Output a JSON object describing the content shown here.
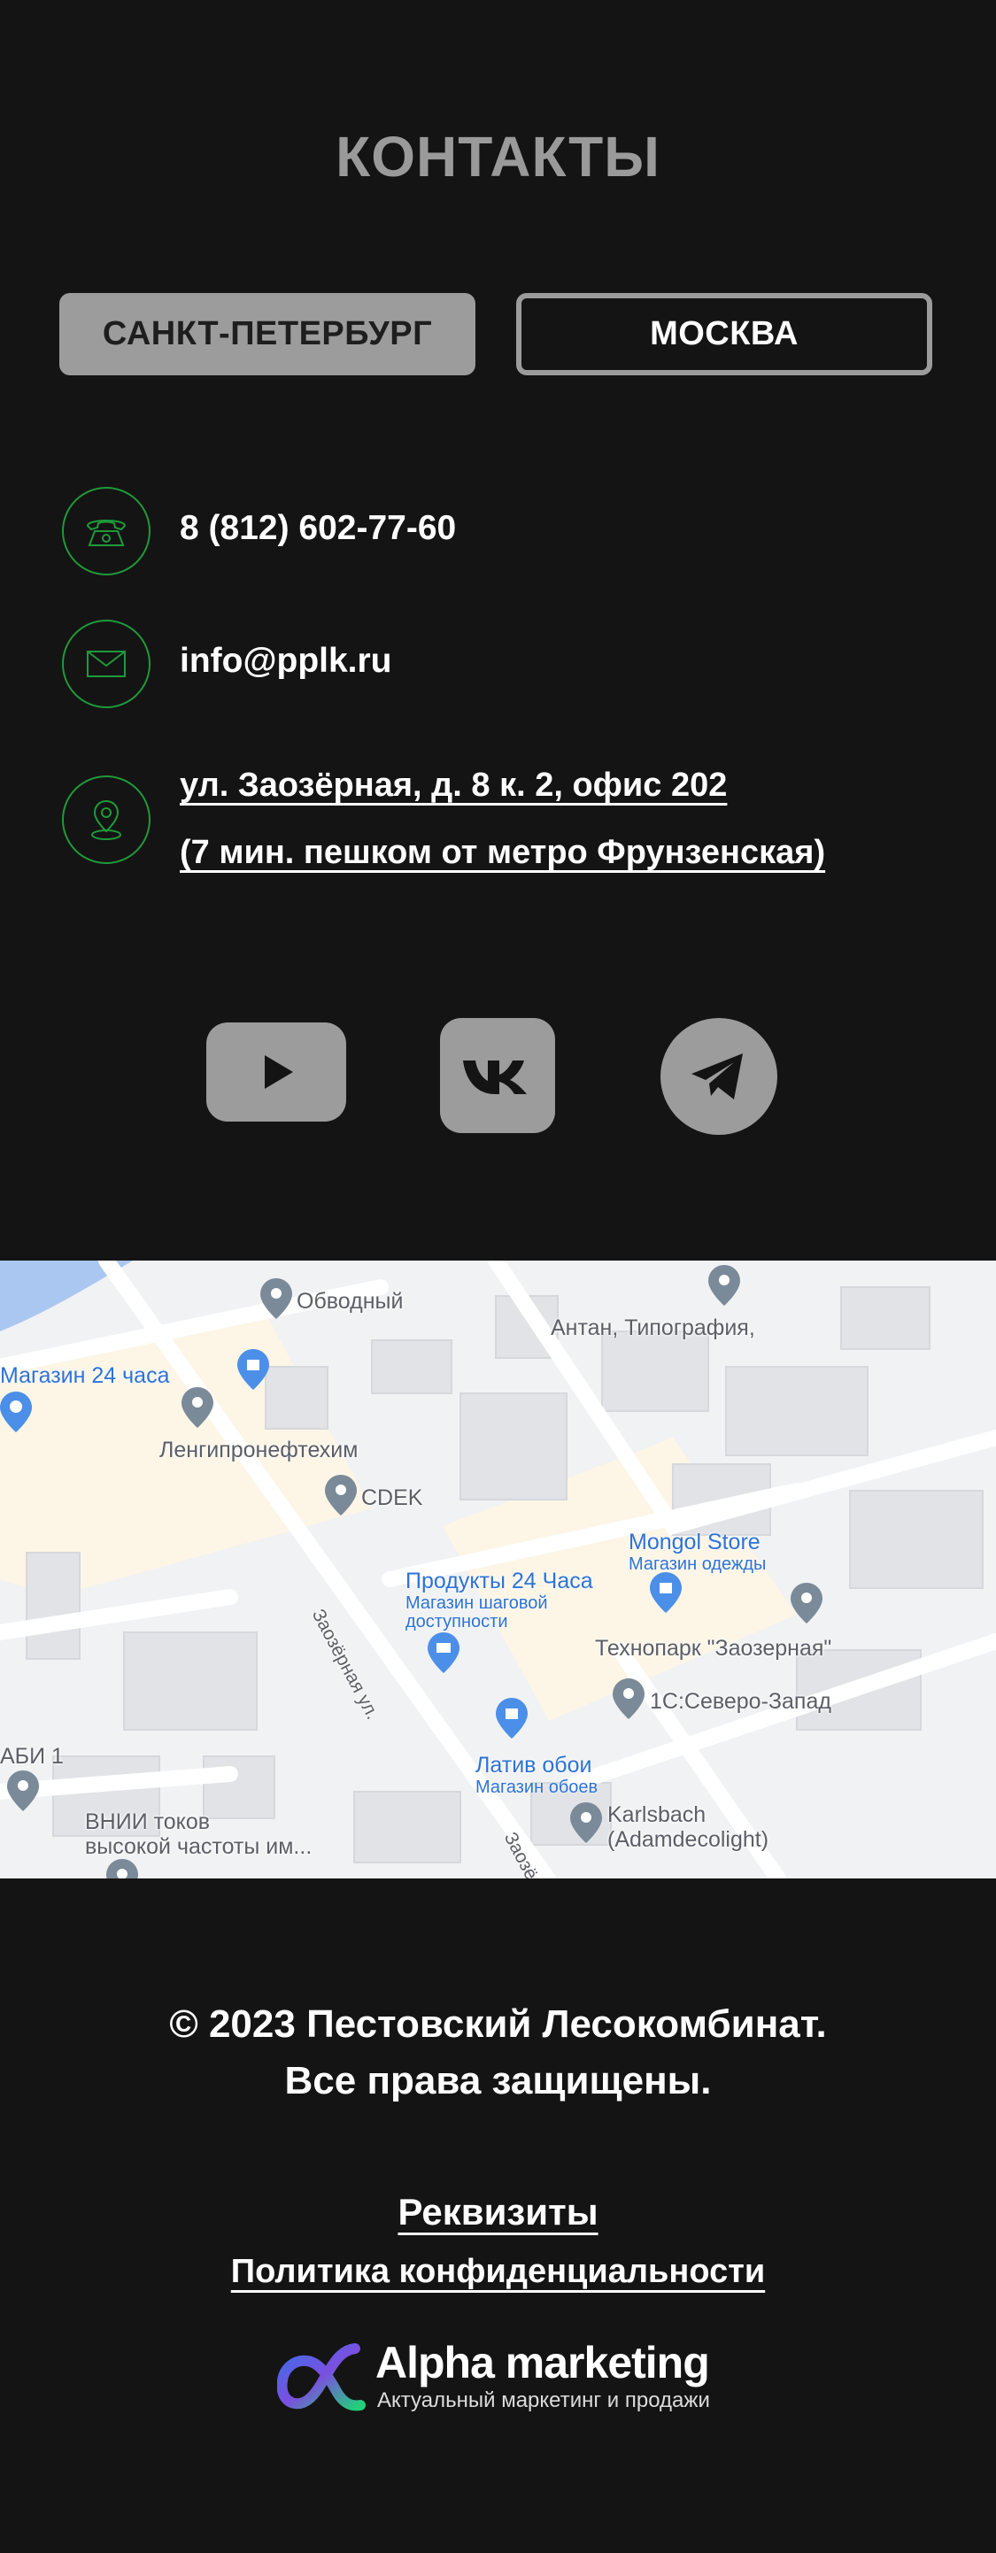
{
  "page": {
    "title": "КОНТАКТЫ"
  },
  "tabs": [
    {
      "label": "САНКТ-ПЕТЕРБУРГ",
      "active": true
    },
    {
      "label": "МОСКВА",
      "active": false
    }
  ],
  "contacts": {
    "phone": "8 (812) 602-77-60",
    "email": "info@pplk.ru",
    "address_line1": "ул. Заозёрная, д. 8 к. 2, офис 202",
    "address_line2": "(7 мин. пешком от метро Фрунзенская)"
  },
  "social": [
    "youtube-icon",
    "vk-icon",
    "telegram-icon"
  ],
  "map": {
    "labels": {
      "obvodny": "Обводный",
      "antan": "Антан, Типография,",
      "shop24": "Магазин 24 часа",
      "lengiproneft": "Ленгипронефтехим",
      "cdek": "CDEK",
      "mongol": "Mongol Store",
      "mongol_sub": "Магазин одежды",
      "products": "Продукты 24 Часа",
      "products_sub1": "Магазин шаговой",
      "products_sub2": "доступности",
      "street": "Заозёрная ул.",
      "street2": "Заозё",
      "technopark": "Технопарк \"Заозерная\"",
      "onec": "1С:Северо-Запад",
      "abi": "АБИ 1",
      "lativ": "Латив обои",
      "lativ_sub": "Магазин обоев",
      "vnii1": "ВНИИ токов",
      "vnii2": "высокой частоты им...",
      "karlsbach1": "Karlsbach",
      "karlsbach2": "(Adamdecolight)"
    }
  },
  "footer": {
    "copyright_line1": "© 2023 Пестовский Лесокомбинат.",
    "copyright_line2": "Все права защищены.",
    "requisites": "Реквизиты",
    "privacy": "Политика конфиденциальности",
    "brand_name": "Alpha marketing",
    "brand_tagline": "Актуальный маркетинг и продажи"
  },
  "colors": {
    "background": "#141414",
    "accent_green": "#1f9a3a",
    "button_gray": "#9c9c9c"
  }
}
